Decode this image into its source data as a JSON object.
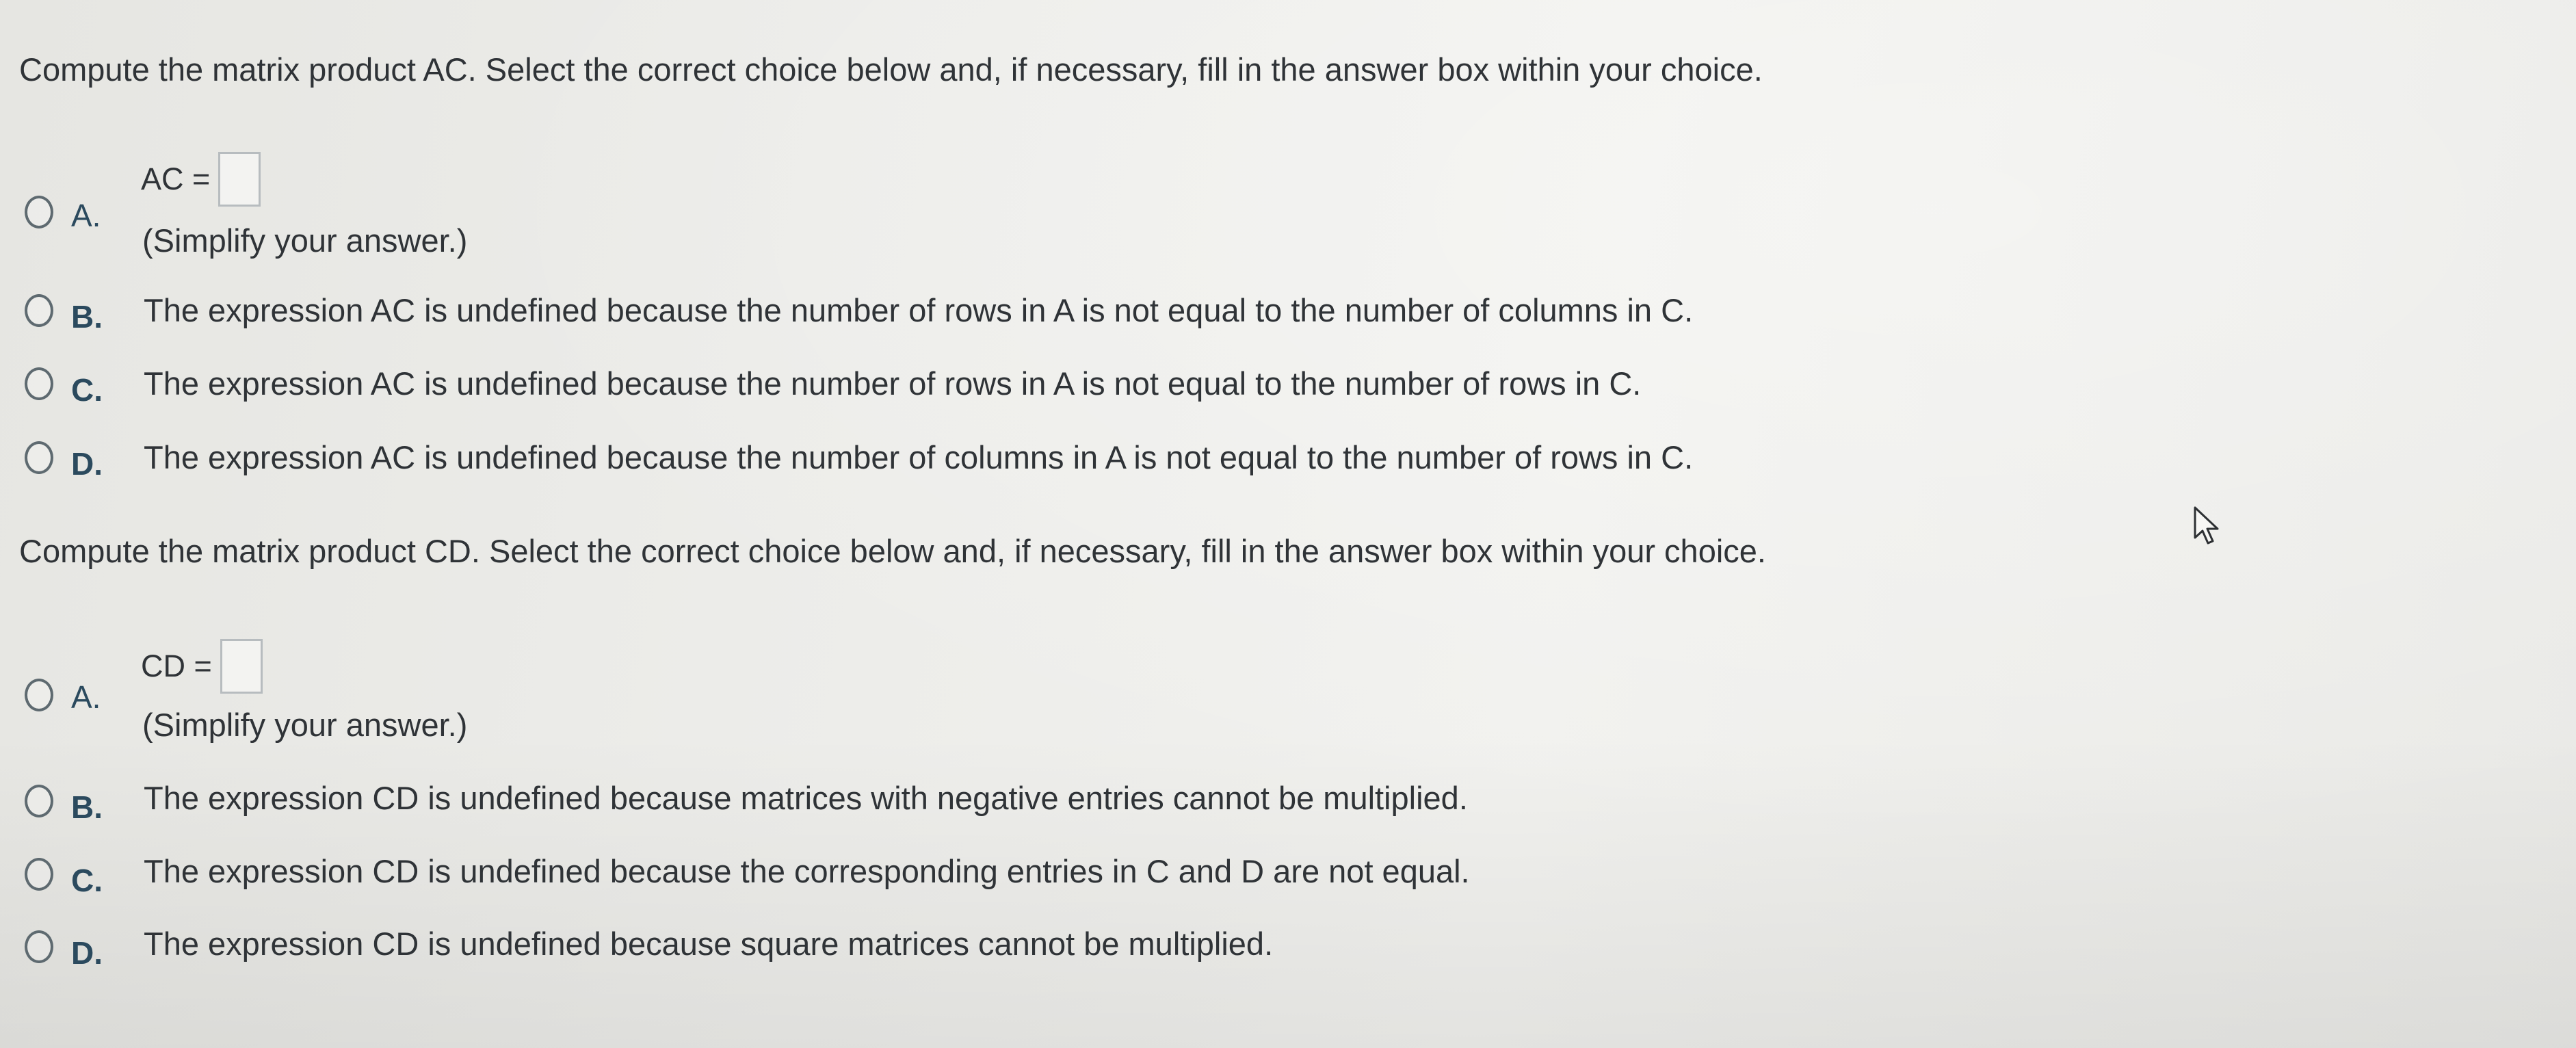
{
  "sections": [
    {
      "question": "Compute the matrix product AC. Select the correct choice below and, if necessary, fill in the answer box within your choice.",
      "choice_a": {
        "letter": "A.",
        "equation": "AC =",
        "hint": "(Simplify your answer.)"
      },
      "choices": [
        {
          "letter": "B.",
          "text": "The expression AC is undefined because the number of rows in A is not equal to the number of columns in C."
        },
        {
          "letter": "C.",
          "text": "The expression AC is undefined because the number of rows in A is not equal to the number of rows in C."
        },
        {
          "letter": "D.",
          "text": "The expression AC is undefined because the number of columns in A is not equal to the number of rows in C."
        }
      ]
    },
    {
      "question": "Compute the matrix product CD. Select the correct choice below and, if necessary, fill in the answer box within your choice.",
      "choice_a": {
        "letter": "A.",
        "equation": "CD =",
        "hint": "(Simplify your answer.)"
      },
      "choices": [
        {
          "letter": "B.",
          "text": "The expression CD is undefined because matrices with negative entries cannot be multiplied."
        },
        {
          "letter": "C.",
          "text": "The expression CD is undefined because the corresponding entries in C and D are not equal."
        },
        {
          "letter": "D.",
          "text": "The expression CD is undefined because square matrices cannot be multiplied."
        }
      ]
    }
  ],
  "colors": {
    "text": "#2f3337",
    "letter": "#2b4a5e",
    "radio_border": "#5e6a70",
    "answer_box_border": "#b7bcbf"
  },
  "icons": {
    "radio": "radio-button-empty",
    "cursor": "mouse-pointer-arrow"
  }
}
